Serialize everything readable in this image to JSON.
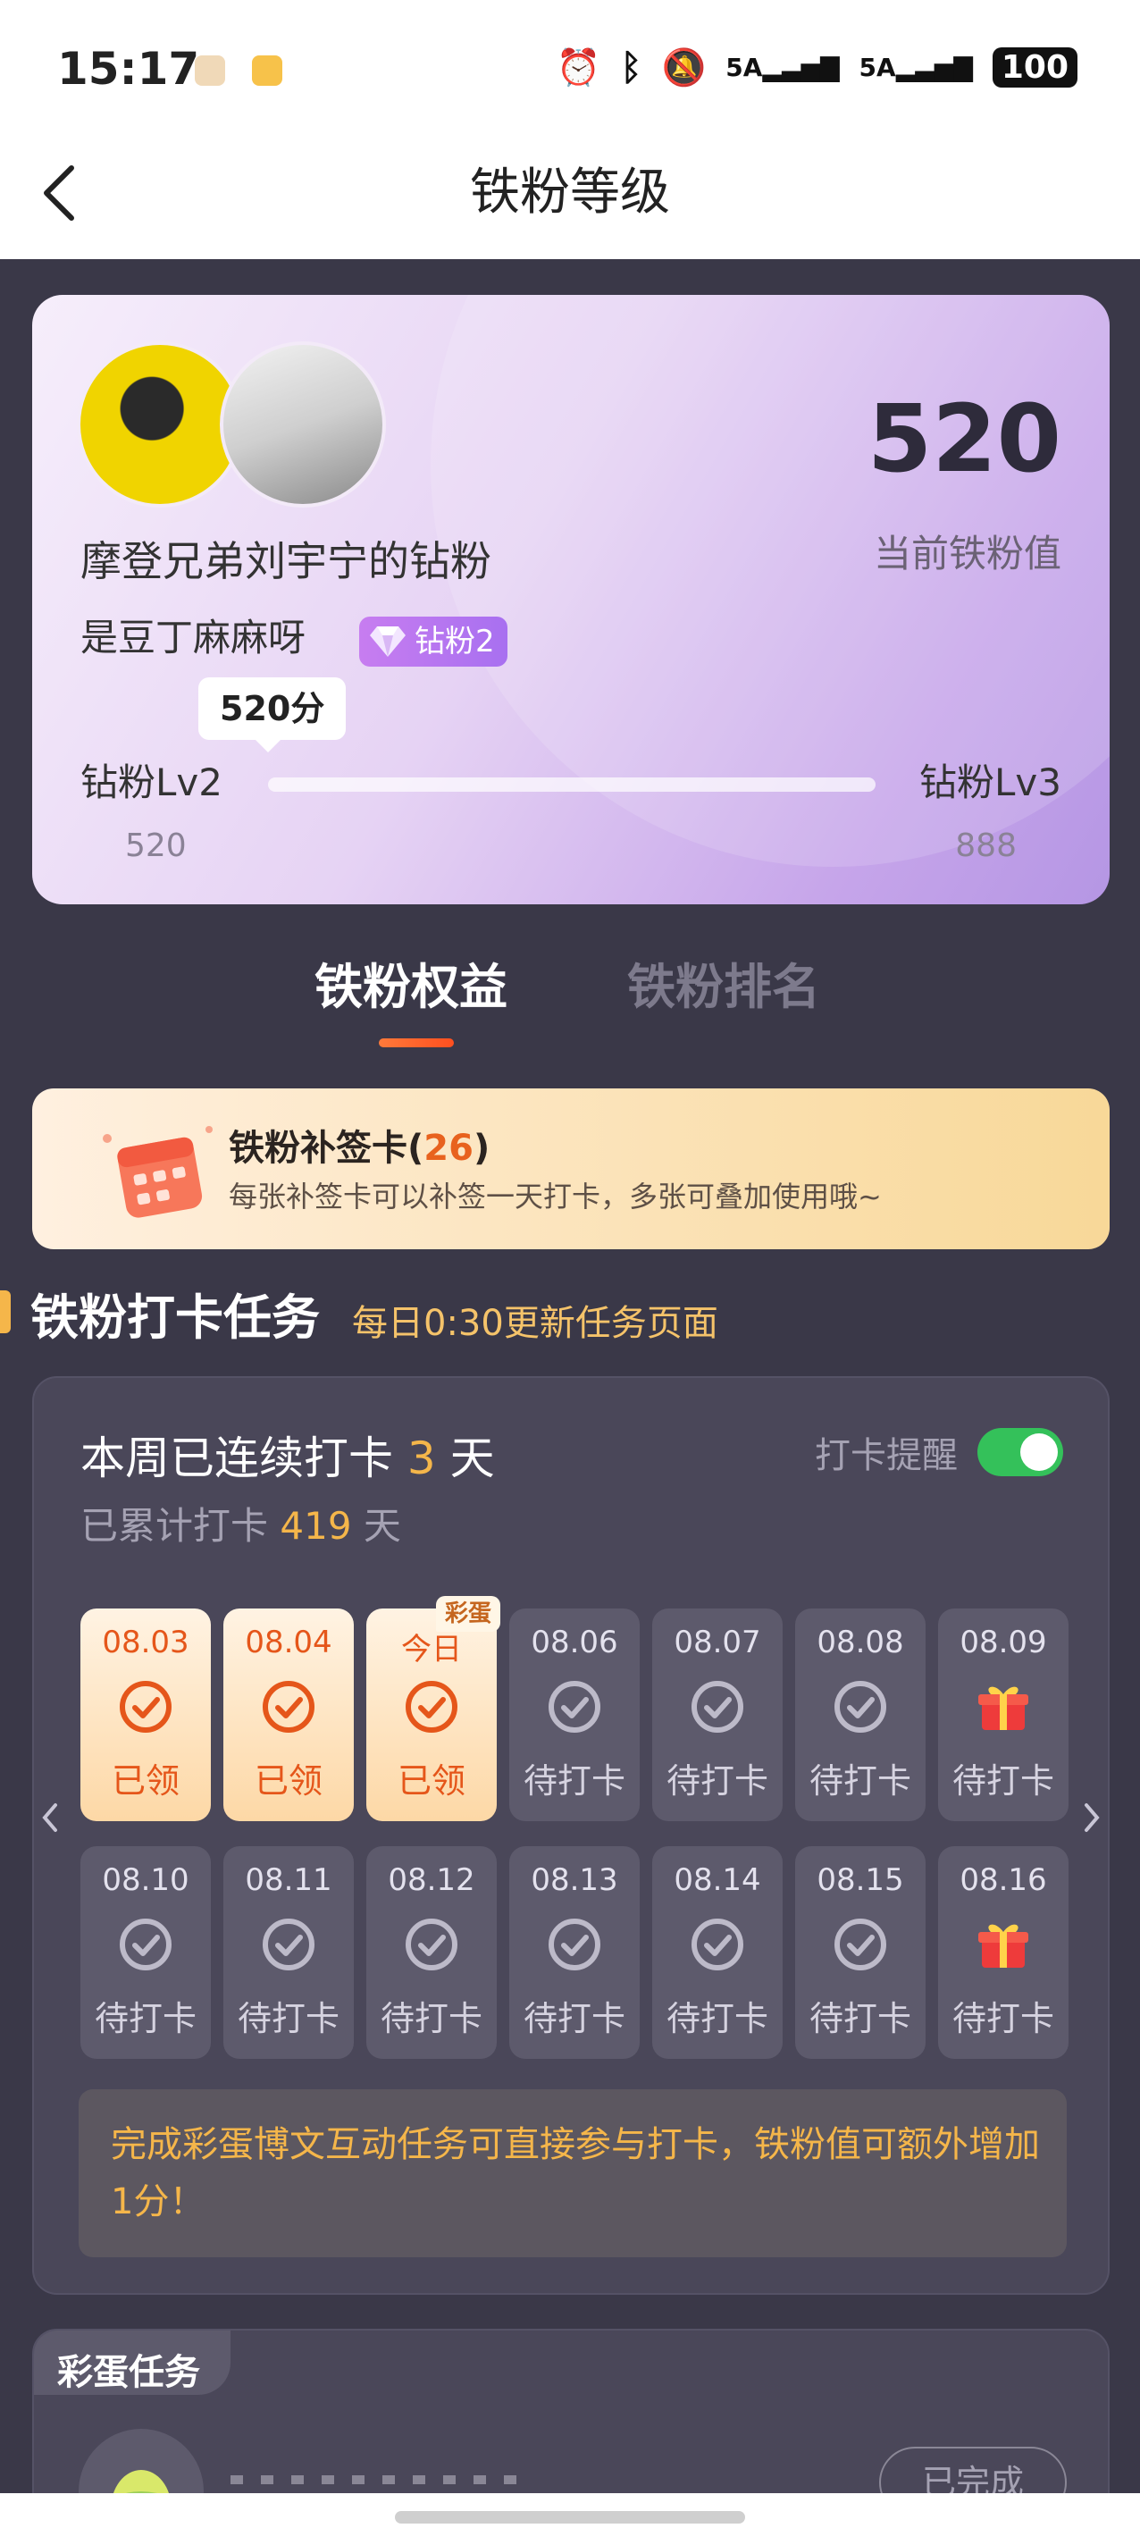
{
  "status": {
    "time": "15:17",
    "net1": "5A",
    "net2": "5A",
    "battery": "100"
  },
  "nav": {
    "title": "铁粉等级"
  },
  "profile": {
    "fan_title": "摩登兄弟刘宇宁的钻粉",
    "user_name": "是豆丁麻麻呀",
    "badge": "钻粉2",
    "score": "520",
    "score_label": "当前铁粉值",
    "bubble": "520分",
    "level_current": "钻粉Lv2",
    "level_next": "钻粉Lv3",
    "level_current_value": "520",
    "level_next_value": "888",
    "progress_fraction": 0.0
  },
  "tabs": [
    {
      "label": "铁粉权益",
      "active": true
    },
    {
      "label": "铁粉排名",
      "active": false
    }
  ],
  "makeup_card": {
    "title": "铁粉补签卡(",
    "count": "26",
    "title_end": ")",
    "desc": "每张补签卡可以补签一天打卡，多张可叠加使用哦~"
  },
  "section": {
    "title": "铁粉打卡任务",
    "subtitle": "每日0:30更新任务页面"
  },
  "checkin": {
    "streak_prefix": "本周已连续打卡",
    "streak_days": "3",
    "streak_suffix": "天",
    "total_prefix": "已累计打卡",
    "total_days": "419",
    "total_suffix": "天",
    "remind_label": "打卡提醒",
    "remind_on": true,
    "egg_tag": "彩蛋",
    "days": [
      {
        "date": "08.03",
        "status": "已领",
        "state": "done",
        "icon": "check-circle-icon"
      },
      {
        "date": "08.04",
        "status": "已领",
        "state": "done",
        "icon": "check-circle-icon"
      },
      {
        "date": "今日",
        "status": "已领",
        "state": "done",
        "icon": "check-circle-icon"
      },
      {
        "date": "08.06",
        "status": "待打卡",
        "state": "pending",
        "icon": "check-circle-icon"
      },
      {
        "date": "08.07",
        "status": "待打卡",
        "state": "pending",
        "icon": "check-circle-icon"
      },
      {
        "date": "08.08",
        "status": "待打卡",
        "state": "pending",
        "icon": "check-circle-icon"
      },
      {
        "date": "08.09",
        "status": "待打卡",
        "state": "pending",
        "icon": "gift-icon"
      },
      {
        "date": "08.10",
        "status": "待打卡",
        "state": "pending",
        "icon": "check-circle-icon"
      },
      {
        "date": "08.11",
        "status": "待打卡",
        "state": "pending",
        "icon": "check-circle-icon"
      },
      {
        "date": "08.12",
        "status": "待打卡",
        "state": "pending",
        "icon": "check-circle-icon"
      },
      {
        "date": "08.13",
        "status": "待打卡",
        "state": "pending",
        "icon": "check-circle-icon"
      },
      {
        "date": "08.14",
        "status": "待打卡",
        "state": "pending",
        "icon": "check-circle-icon"
      },
      {
        "date": "08.15",
        "status": "待打卡",
        "state": "pending",
        "icon": "check-circle-icon"
      },
      {
        "date": "08.16",
        "status": "待打卡",
        "state": "pending",
        "icon": "gift-icon"
      }
    ],
    "tip": "完成彩蛋博文互动任务可直接参与打卡，铁粉值可额外增加1分！"
  },
  "egg_tasks": {
    "title": "彩蛋任务",
    "button": "已完成"
  },
  "colors": {
    "accent_orange": "#e5561a",
    "gold": "#f5b64a",
    "toggle_green": "#34c15a"
  }
}
